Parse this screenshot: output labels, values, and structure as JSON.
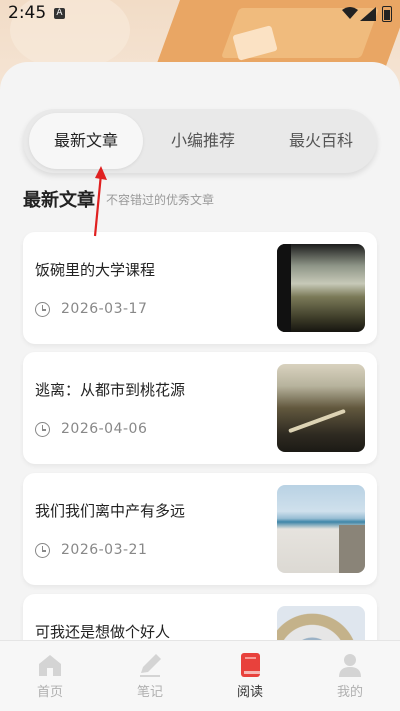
{
  "status_bar": {
    "time": "2:45",
    "notif_glyph": "A"
  },
  "tabs": [
    {
      "label": "最新文章",
      "active": true
    },
    {
      "label": "小编推荐",
      "active": false
    },
    {
      "label": "最火百科",
      "active": false
    }
  ],
  "section": {
    "title": "最新文章",
    "subtitle": "不容错过的优秀文章"
  },
  "articles": [
    {
      "title": "饭碗里的大学课程",
      "date": "2026-03-17"
    },
    {
      "title": "逃离：从都市到桃花源",
      "date": "2026-04-06"
    },
    {
      "title": "我们我们离中产有多远",
      "date": "2026-03-21"
    },
    {
      "title": "可我还是想做个好人",
      "date": ""
    }
  ],
  "nav": [
    {
      "label": "首页",
      "icon": "home-icon",
      "active": false
    },
    {
      "label": "笔记",
      "icon": "pen-icon",
      "active": false
    },
    {
      "label": "阅读",
      "icon": "book-icon",
      "active": true
    },
    {
      "label": "我的",
      "icon": "user-icon",
      "active": false
    }
  ],
  "colors": {
    "accent": "#e8413c",
    "active_text": "#333333",
    "inactive_text": "#b0b0b0",
    "annotation_arrow": "#e02020"
  }
}
